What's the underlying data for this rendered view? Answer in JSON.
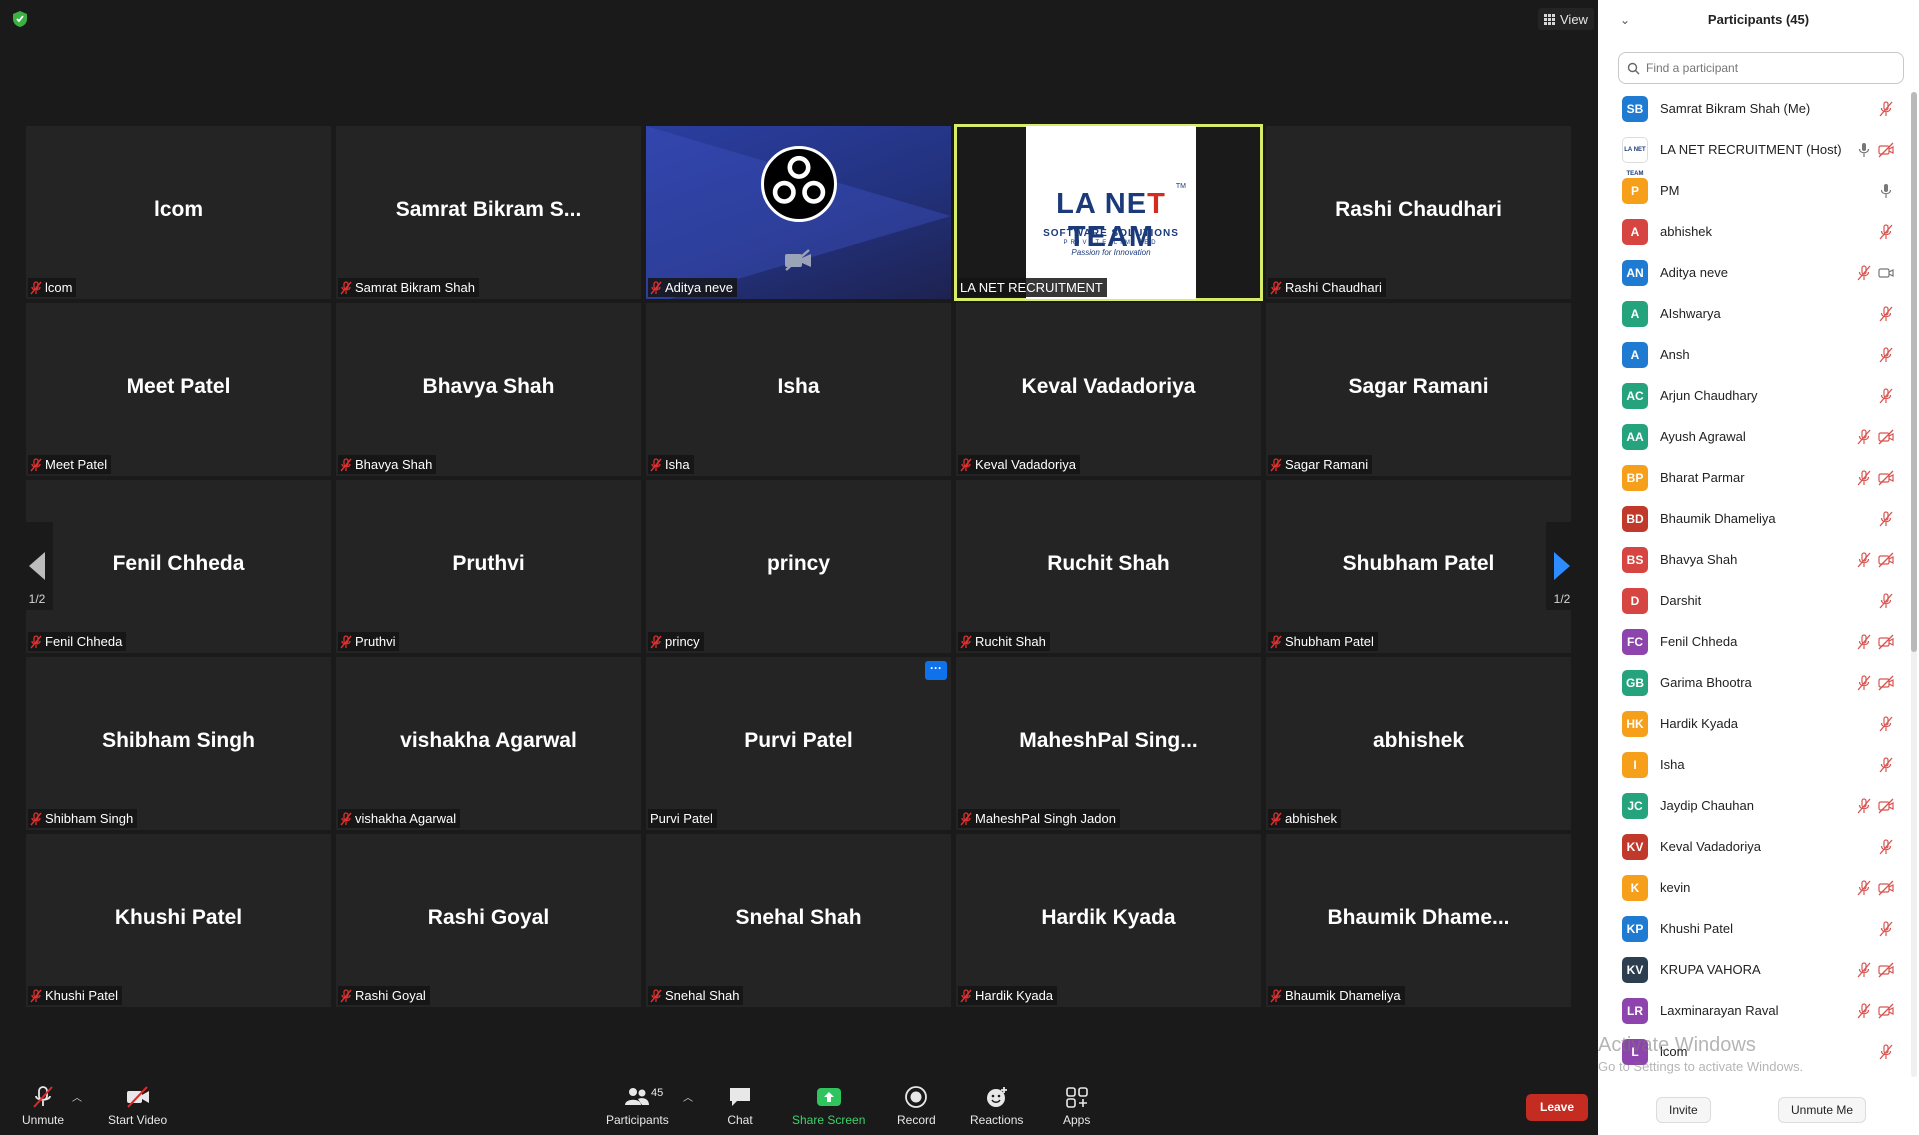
{
  "top": {
    "view_label": "View"
  },
  "tiles": [
    {
      "big": "lcom",
      "label": "lcom"
    },
    {
      "big": "Samrat  Bikram  S...",
      "label": "Samrat Bikram Shah"
    },
    {
      "big": "",
      "label": "Aditya neve",
      "type": "obs"
    },
    {
      "big": "",
      "label": "LA NET RECRUITMENT",
      "type": "active"
    },
    {
      "big": "Rashi Chaudhari",
      "label": "Rashi Chaudhari"
    },
    {
      "big": "Meet Patel",
      "label": "Meet Patel"
    },
    {
      "big": "Bhavya Shah",
      "label": "Bhavya Shah"
    },
    {
      "big": "Isha",
      "label": "Isha"
    },
    {
      "big": "Keval Vadadoriya",
      "label": "Keval Vadadoriya"
    },
    {
      "big": "Sagar Ramani",
      "label": "Sagar Ramani"
    },
    {
      "big": "Fenil Chheda",
      "label": "Fenil Chheda"
    },
    {
      "big": "Pruthvi",
      "label": "Pruthvi"
    },
    {
      "big": "princy",
      "label": "princy"
    },
    {
      "big": "Ruchit Shah",
      "label": "Ruchit Shah"
    },
    {
      "big": "Shubham Patel",
      "label": "Shubham Patel"
    },
    {
      "big": "Shibham Singh",
      "label": "Shibham Singh"
    },
    {
      "big": "vishakha Agarwal",
      "label": "vishakha Agarwal"
    },
    {
      "big": "Purvi Patel",
      "label": "Purvi Patel",
      "more": "···",
      "mic": "none"
    },
    {
      "big": "MaheshPal  Sing...",
      "label": "MaheshPal Singh Jadon"
    },
    {
      "big": "abhishek",
      "label": "abhishek"
    },
    {
      "big": "Khushi Patel",
      "label": "Khushi Patel"
    },
    {
      "big": "Rashi Goyal",
      "label": "Rashi Goyal"
    },
    {
      "big": "Snehal Shah",
      "label": "Snehal Shah"
    },
    {
      "big": "Hardik Kyada",
      "label": "Hardik Kyada"
    },
    {
      "big": "Bhaumik  Dhame...",
      "label": "Bhaumik Dhameliya"
    }
  ],
  "active_logo": {
    "line1a": "LA NE",
    "line1b": "T",
    "line1c": " TEAM",
    "line2": "SOFTWARE SOLUTIONS",
    "line3": "PRIVATE LIMITED",
    "line4": "Passion for Innovation",
    "tm": "TM"
  },
  "paging": {
    "left": "1/2",
    "right": "1/2"
  },
  "toolbar": {
    "unmute": "Unmute",
    "start_video": "Start Video",
    "participants": "Participants",
    "participants_count": "45",
    "chat": "Chat",
    "share_screen": "Share Screen",
    "record": "Record",
    "reactions": "Reactions",
    "apps": "Apps",
    "leave": "Leave"
  },
  "panel": {
    "title": "Participants (45)",
    "search_placeholder": "Find a participant",
    "invite": "Invite",
    "unmute_me": "Unmute Me",
    "participants": [
      {
        "initials": "SB",
        "name": "Samrat Bikram Shah (Me)",
        "color": "#1f7bd1",
        "mic": "off",
        "cam": ""
      },
      {
        "initials": "LA NET TEAM",
        "name": "LA NET RECRUITMENT (Host)",
        "color": "logo",
        "mic": "on",
        "cam": "off"
      },
      {
        "initials": "P",
        "name": "PM",
        "color": "#f59f1a",
        "mic": "on",
        "cam": ""
      },
      {
        "initials": "A",
        "name": "abhishek",
        "color": "#d64541",
        "mic": "off",
        "cam": ""
      },
      {
        "initials": "AN",
        "name": "Aditya neve",
        "color": "#1f7bd1",
        "mic": "off",
        "cam": "on"
      },
      {
        "initials": "A",
        "name": "AIshwarya",
        "color": "#25a37c",
        "mic": "off",
        "cam": ""
      },
      {
        "initials": "A",
        "name": "Ansh",
        "color": "#1f7bd1",
        "mic": "off",
        "cam": ""
      },
      {
        "initials": "AC",
        "name": "Arjun Chaudhary",
        "color": "#25a37c",
        "mic": "off",
        "cam": ""
      },
      {
        "initials": "AA",
        "name": "Ayush Agrawal",
        "color": "#25a37c",
        "mic": "off",
        "cam": "off"
      },
      {
        "initials": "BP",
        "name": "Bharat Parmar",
        "color": "#f59f1a",
        "mic": "off",
        "cam": "off"
      },
      {
        "initials": "BD",
        "name": "Bhaumik Dhameliya",
        "color": "#c0392b",
        "mic": "off",
        "cam": ""
      },
      {
        "initials": "BS",
        "name": "Bhavya Shah",
        "color": "#d64541",
        "mic": "off",
        "cam": "off"
      },
      {
        "initials": "D",
        "name": "Darshit",
        "color": "#d64541",
        "mic": "off",
        "cam": ""
      },
      {
        "initials": "FC",
        "name": "Fenil Chheda",
        "color": "#8e44ad",
        "mic": "off",
        "cam": "off"
      },
      {
        "initials": "GB",
        "name": "Garima Bhootra",
        "color": "#25a37c",
        "mic": "off",
        "cam": "off"
      },
      {
        "initials": "HK",
        "name": "Hardik Kyada",
        "color": "#f59f1a",
        "mic": "off",
        "cam": ""
      },
      {
        "initials": "I",
        "name": "Isha",
        "color": "#f59f1a",
        "mic": "off",
        "cam": ""
      },
      {
        "initials": "JC",
        "name": "Jaydip Chauhan",
        "color": "#25a37c",
        "mic": "off",
        "cam": "off"
      },
      {
        "initials": "KV",
        "name": "Keval Vadadoriya",
        "color": "#c0392b",
        "mic": "off",
        "cam": ""
      },
      {
        "initials": "K",
        "name": "kevin",
        "color": "#f59f1a",
        "mic": "off",
        "cam": "off"
      },
      {
        "initials": "KP",
        "name": "Khushi Patel",
        "color": "#1f7bd1",
        "mic": "off",
        "cam": ""
      },
      {
        "initials": "KV",
        "name": "KRUPA VAHORA",
        "color": "#2c3e50",
        "mic": "off",
        "cam": "off"
      },
      {
        "initials": "LR",
        "name": "Laxminarayan Raval",
        "color": "#8e44ad",
        "mic": "off",
        "cam": "off"
      },
      {
        "initials": "L",
        "name": "lcom",
        "color": "#8e44ad",
        "mic": "off",
        "cam": ""
      }
    ]
  },
  "watermark": {
    "line1": "Activate Windows",
    "line2": "Go to Settings to activate Windows."
  }
}
